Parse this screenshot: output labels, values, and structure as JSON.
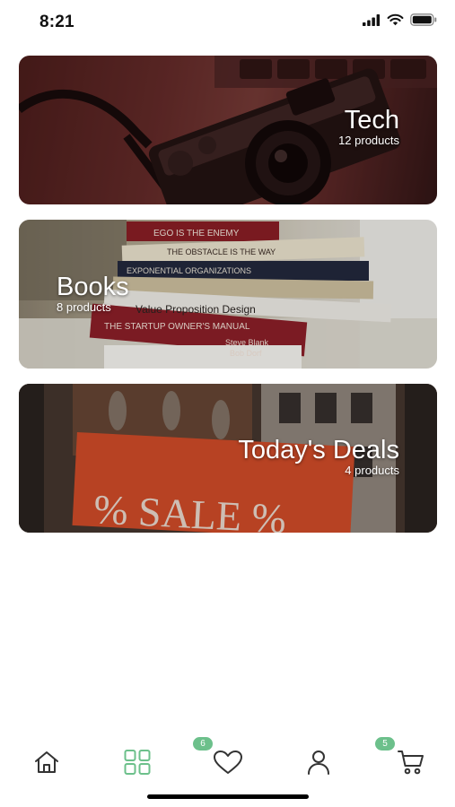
{
  "status_bar": {
    "time": "8:21",
    "icons": [
      "signal-icon",
      "wifi-icon",
      "battery-icon"
    ]
  },
  "categories": [
    {
      "title": "Tech",
      "count": "12 products",
      "image": "camera-on-laptop"
    },
    {
      "title": "Books",
      "count": "8 products",
      "image": "stack-of-books"
    },
    {
      "title": "Today's Deals",
      "count": "4 products",
      "image": "sale-sign"
    }
  ],
  "books_spines": [
    "EGO IS THE ENEMY",
    "THE OBSTACLE IS THE WAY",
    "EXPONENTIAL ORGANIZATIONS",
    "Value Proposition Design",
    "THE STARTUP OWNER'S MANUAL",
    "Steve Blank",
    "Bob Dorf"
  ],
  "deals_sign": "% SALE %",
  "nav": {
    "items": [
      "home-icon",
      "categories-icon",
      "favorites-icon",
      "profile-icon",
      "cart-icon"
    ],
    "active": "categories-icon",
    "favorites_badge": "6",
    "cart_badge": "5"
  },
  "colors": {
    "accent": "#6cc08b",
    "icon": "#333333",
    "active_icon": "#6cc08b"
  }
}
